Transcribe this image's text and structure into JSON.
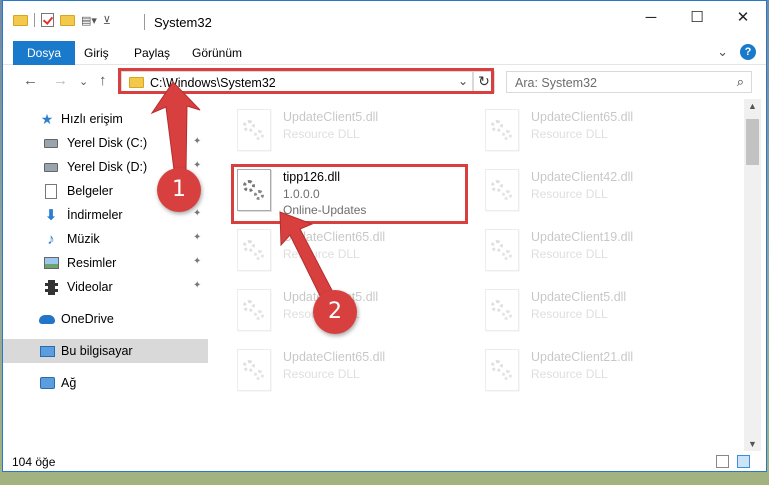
{
  "window": {
    "title": "System32",
    "controls": {
      "minimize": "─",
      "maximize": "☐",
      "close": "✕"
    }
  },
  "ribbon": {
    "tabs": [
      "Dosya",
      "Giriş",
      "Paylaş",
      "Görünüm"
    ],
    "expand_glyph": "⌄",
    "help_glyph": "?"
  },
  "navigation": {
    "back": "←",
    "forward": "→",
    "recent": "⌄",
    "up": "↑",
    "address_path": "C:\\Windows\\System32",
    "address_dropdown": "⌄",
    "refresh": "↻",
    "search_placeholder": "Ara: System32",
    "search_glyph": "⌕"
  },
  "sidebar": {
    "quick_access": "Hızlı erişim",
    "items": [
      {
        "label": "Yerel Disk (C:)",
        "icon": "drive-icon",
        "pinned": true
      },
      {
        "label": "Yerel Disk (D:)",
        "icon": "drive-icon",
        "pinned": true
      },
      {
        "label": "Belgeler",
        "icon": "documents-icon",
        "pinned": true
      },
      {
        "label": "İndirmeler",
        "icon": "downloads-icon",
        "pinned": true
      },
      {
        "label": "Müzik",
        "icon": "music-icon",
        "pinned": true
      },
      {
        "label": "Resimler",
        "icon": "pictures-icon",
        "pinned": true
      },
      {
        "label": "Videolar",
        "icon": "videos-icon",
        "pinned": true
      }
    ],
    "onedrive": "OneDrive",
    "this_pc": "Bu bilgisayar",
    "network": "Ağ",
    "pin_glyph": "📌"
  },
  "files": {
    "highlighted": {
      "name": "tipp126.dll",
      "version": "1.0.0.0",
      "company": "Online-Updates"
    },
    "background": [
      {
        "name": "UpdateClient5.dll",
        "desc": "Resource DLL"
      },
      {
        "name": "UpdateClient65.dll",
        "desc": "Resource DLL"
      },
      {
        "name": "UpdateClient42.dll",
        "desc": "Resource DLL"
      },
      {
        "name": "UpdateClient65.dll",
        "desc": "Resource DLL"
      },
      {
        "name": "UpdateClient19.dll",
        "desc": "Resource DLL"
      },
      {
        "name": "UpdateClient5.dll",
        "desc": "Resource DLL"
      },
      {
        "name": "UpdateClient5.dll",
        "desc": "Resource DLL"
      },
      {
        "name": "UpdateClient65.dll",
        "desc": "Resource DLL"
      },
      {
        "name": "UpdateClient21.dll",
        "desc": "Resource DLL"
      }
    ]
  },
  "status": {
    "item_count": "104 öğe"
  },
  "annotations": {
    "step1": "1",
    "step2": "2",
    "color": "#d8403f"
  }
}
